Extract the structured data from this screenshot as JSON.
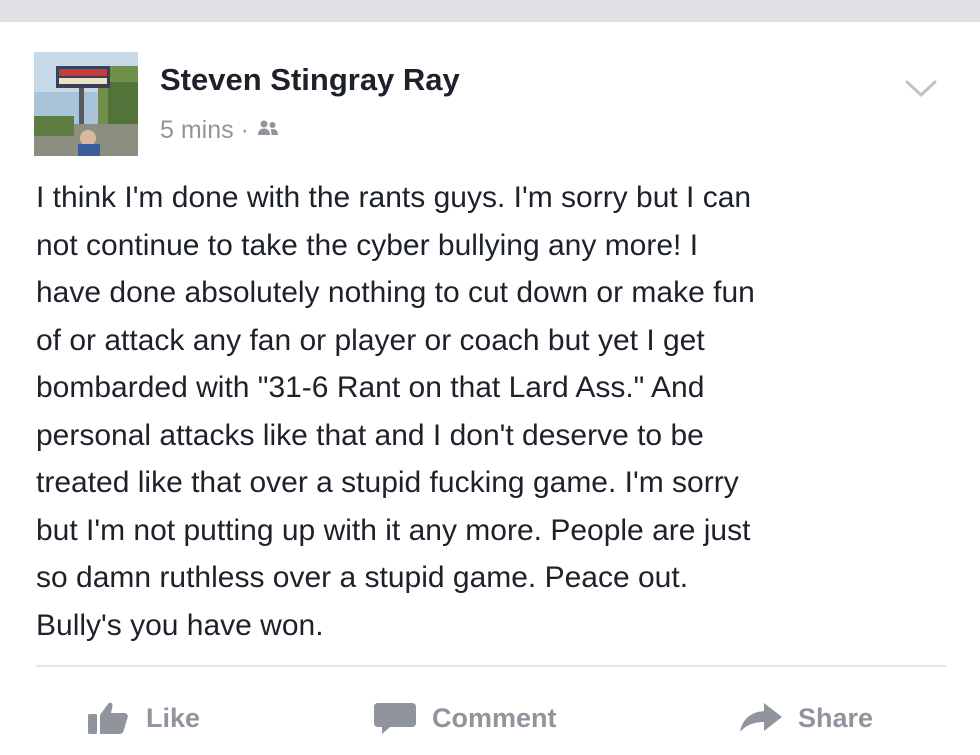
{
  "post": {
    "author": "Steven Stingray Ray",
    "time": "5 mins",
    "separator": "·",
    "privacy_icon": "friends-icon",
    "text": "I think I'm done with the rants guys. I'm sorry but I can\nnot continue to take the cyber bullying any more! I\nhave done absolutely nothing to cut down or make fun\nof or attack any fan or player or coach but yet I get\nbombarded with \"31-6 Rant on that Lard Ass.\" And\npersonal attacks like that and I don't deserve to be\ntreated like that over a stupid fucking game. I'm sorry\nbut I'm not putting up with it any more. People are just\nso damn ruthless over a stupid game. Peace out.\nBully's you have won."
  },
  "actions": {
    "like": "Like",
    "comment": "Comment",
    "share": "Share"
  },
  "colors": {
    "text": "#1d2129",
    "secondary": "#90949c",
    "divider": "#e5e6e9",
    "top_bar": "#dfe1e6"
  }
}
